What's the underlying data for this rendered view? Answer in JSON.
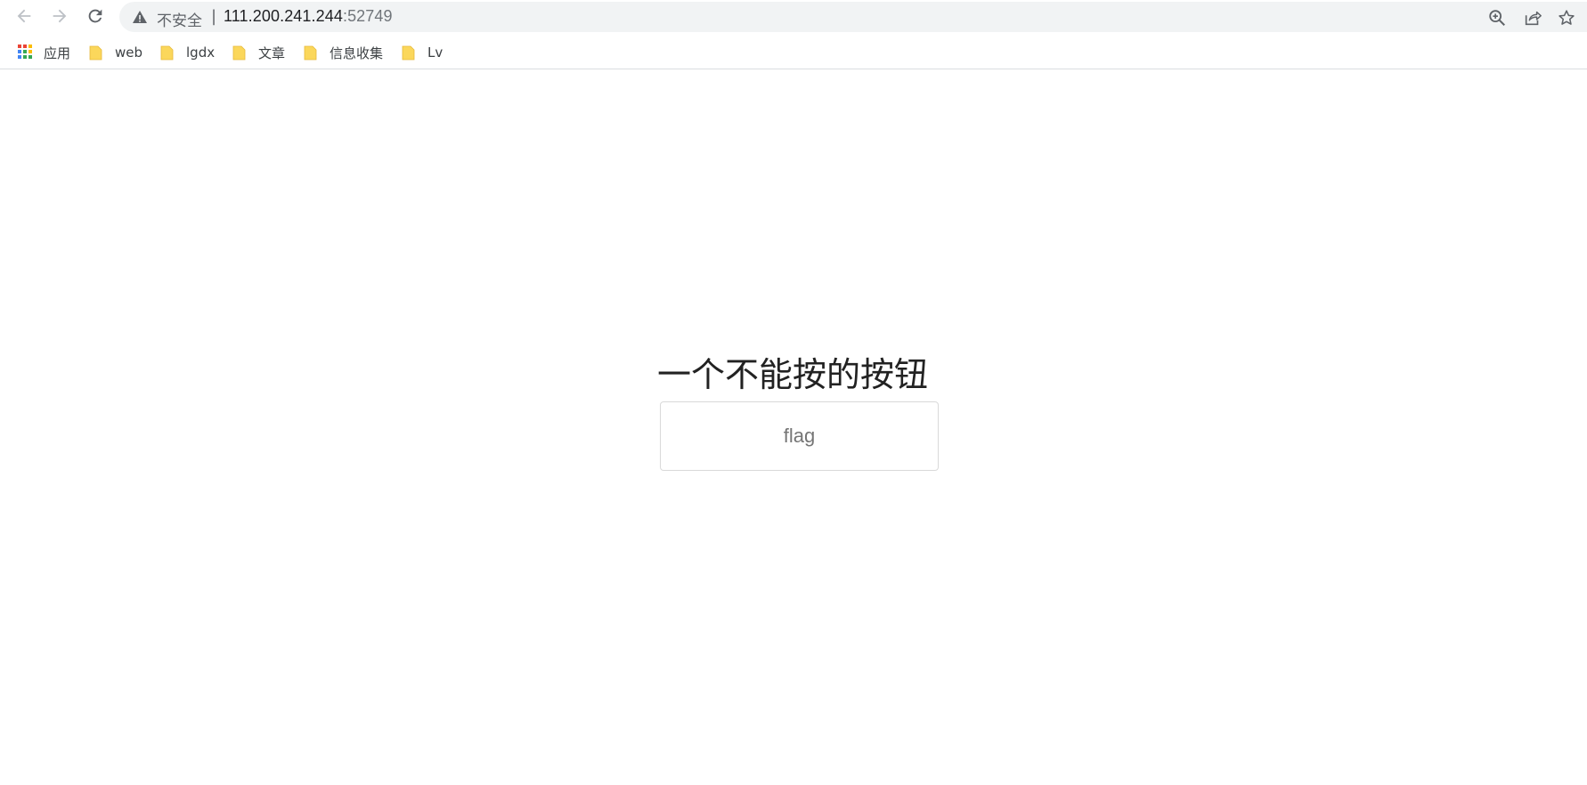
{
  "toolbar": {
    "back_icon": "arrow-left-icon",
    "forward_icon": "arrow-right-icon",
    "reload_icon": "reload-icon"
  },
  "omnibox": {
    "security_label": "不安全",
    "separator": "|",
    "host": "111.200.241.244",
    "port": ":52749",
    "icons": [
      "zoom-icon",
      "share-icon",
      "star-icon"
    ]
  },
  "bookmarks": {
    "apps_label": "应用",
    "folders": [
      "web",
      "lgdx",
      "文章",
      "信息收集",
      "Lv"
    ]
  },
  "page": {
    "heading": "一个不能按的按钮",
    "button_label": "flag"
  },
  "colors": {
    "folder": "#fbd75b",
    "omnibox_bg": "#f1f3f4",
    "button_border": "#d9d9d9"
  }
}
